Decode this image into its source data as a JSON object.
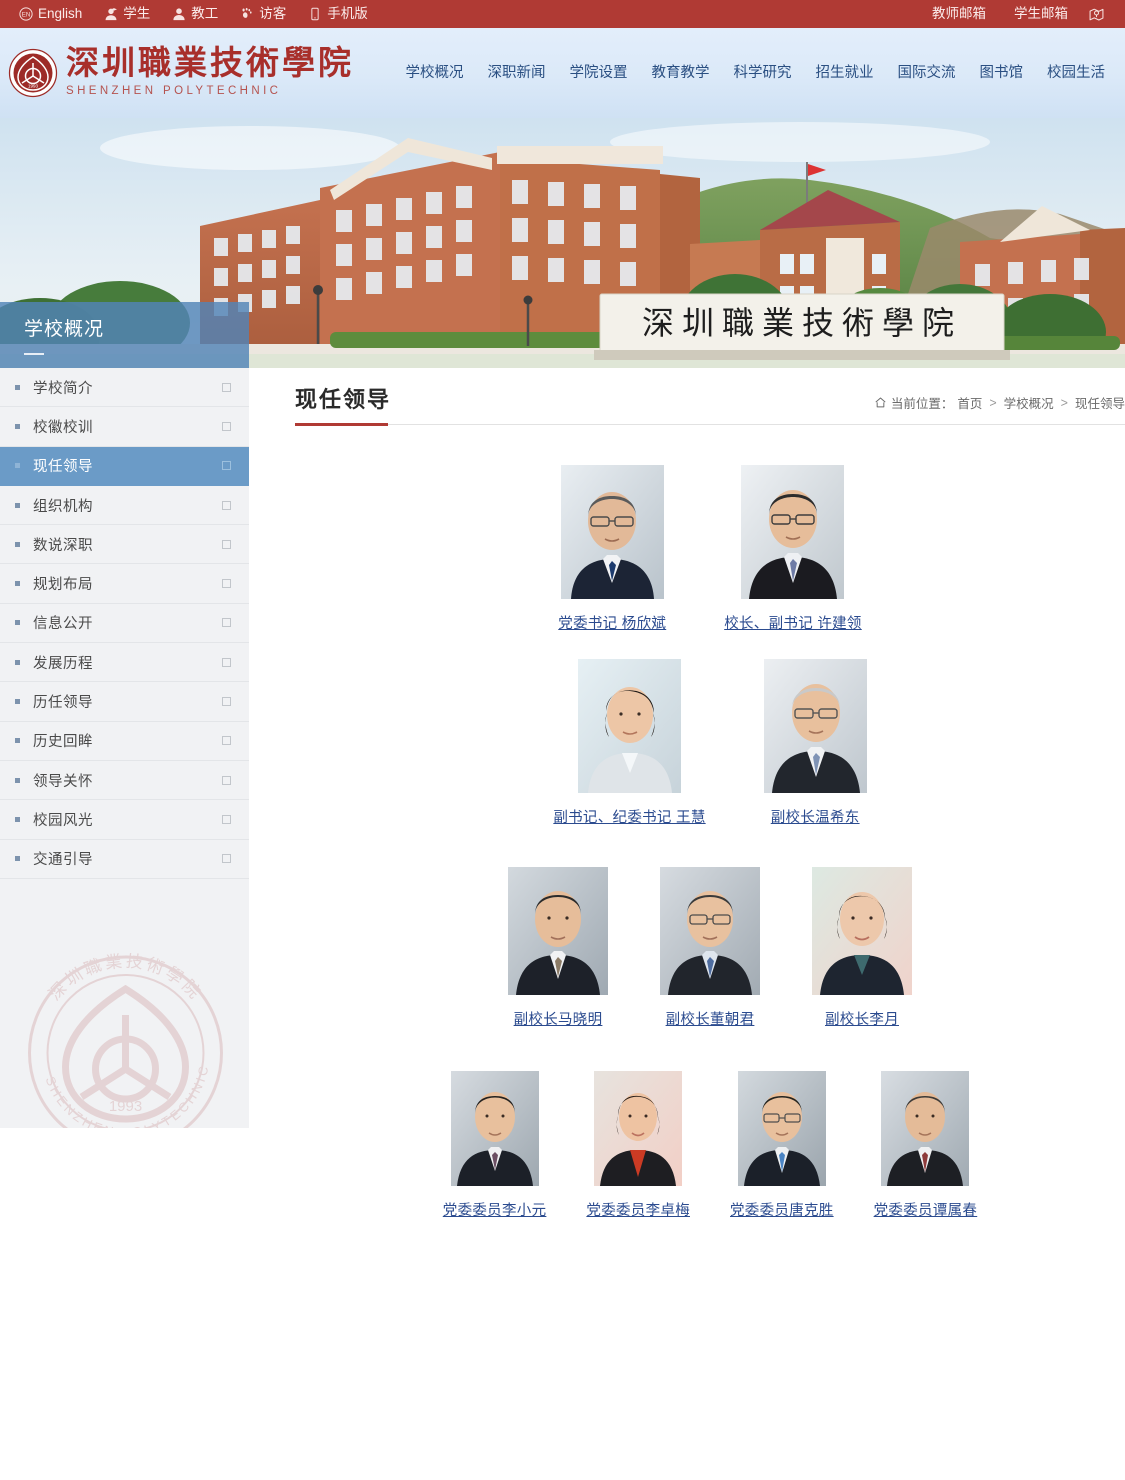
{
  "topbar": {
    "left_items": [
      {
        "label": "English",
        "icon": "en-circle-icon"
      },
      {
        "label": "学生",
        "icon": "student-icon"
      },
      {
        "label": "教工",
        "icon": "staff-icon"
      },
      {
        "label": "访客",
        "icon": "visitor-icon"
      },
      {
        "label": "手机版",
        "icon": "mobile-icon"
      }
    ],
    "right_items": [
      {
        "label": "教师邮箱"
      },
      {
        "label": "学生邮箱"
      }
    ],
    "map_icon": "map-pin-icon",
    "bg_color": "#b03a34"
  },
  "header": {
    "logo_cn": "深圳職業技術學院",
    "logo_en": "SHENZHEN POLYTECHNIC",
    "seal_icon": "school-seal-icon",
    "seal_year": "1993",
    "nav": [
      {
        "label": "学校概况"
      },
      {
        "label": "深职新闻"
      },
      {
        "label": "学院设置"
      },
      {
        "label": "教育教学"
      },
      {
        "label": "科学研究"
      },
      {
        "label": "招生就业"
      },
      {
        "label": "国际交流"
      },
      {
        "label": "图书馆"
      },
      {
        "label": "校园生活"
      }
    ],
    "accent_color": "#a82f2b",
    "nav_color": "#2a4f82"
  },
  "banner": {
    "stone_text": "深圳職業技術學院",
    "alt": "深圳职业技术学院校园全景"
  },
  "sidebar": {
    "header_title": "学校概况",
    "active_index": 2,
    "items": [
      {
        "label": "学校简介"
      },
      {
        "label": "校徽校训"
      },
      {
        "label": "现任领导"
      },
      {
        "label": "组织机构"
      },
      {
        "label": "数说深职"
      },
      {
        "label": "规划布局"
      },
      {
        "label": "信息公开"
      },
      {
        "label": "发展历程"
      },
      {
        "label": "历任领导"
      },
      {
        "label": "历史回眸"
      },
      {
        "label": "领导关怀"
      },
      {
        "label": "校园风光"
      },
      {
        "label": "交通引导"
      }
    ],
    "watermark": {
      "cn": "深圳職業技術學院",
      "en_top": "SHENZHEN",
      "en_bottom": "POLYTECHNIC",
      "year": "1993"
    },
    "active_bg": "#6b9bc7",
    "bg": "#f1f2f4"
  },
  "main": {
    "page_title": "现任领导",
    "breadcrumb": {
      "home_icon": "home-icon",
      "prefix": "当前位置：",
      "items": [
        {
          "label": "首页"
        },
        {
          "label": "学校概况"
        },
        {
          "label": "现任领导"
        }
      ],
      "separator": ">"
    },
    "title_underline_color": "#b03a34",
    "leader_rows": [
      {
        "row": 1,
        "leaders": [
          {
            "name": "党委书记 杨欣斌",
            "photo_alt": "杨欣斌证件照"
          },
          {
            "name": "校长、副书记 许建领",
            "photo_alt": "许建领证件照"
          }
        ]
      },
      {
        "row": 2,
        "leaders": [
          {
            "name": "副书记、纪委书记 王慧",
            "photo_alt": "王慧证件照"
          },
          {
            "name": "副校长温希东",
            "photo_alt": "温希东证件照"
          }
        ]
      },
      {
        "row": 3,
        "leaders": [
          {
            "name": "副校长马晓明",
            "photo_alt": "马晓明证件照"
          },
          {
            "name": "副校长董朝君",
            "photo_alt": "董朝君证件照"
          },
          {
            "name": "副校长李月",
            "photo_alt": "李月证件照"
          }
        ]
      },
      {
        "row": 4,
        "leaders": [
          {
            "name": "党委委员李小元",
            "photo_alt": "李小元证件照"
          },
          {
            "name": "党委委员李卓梅",
            "photo_alt": "李卓梅证件照"
          },
          {
            "name": "党委委员唐克胜",
            "photo_alt": "唐克胜证件照"
          },
          {
            "name": "党委委员谭属春",
            "photo_alt": "谭属春证件照"
          }
        ]
      }
    ],
    "link_color": "#2b4b8f"
  }
}
